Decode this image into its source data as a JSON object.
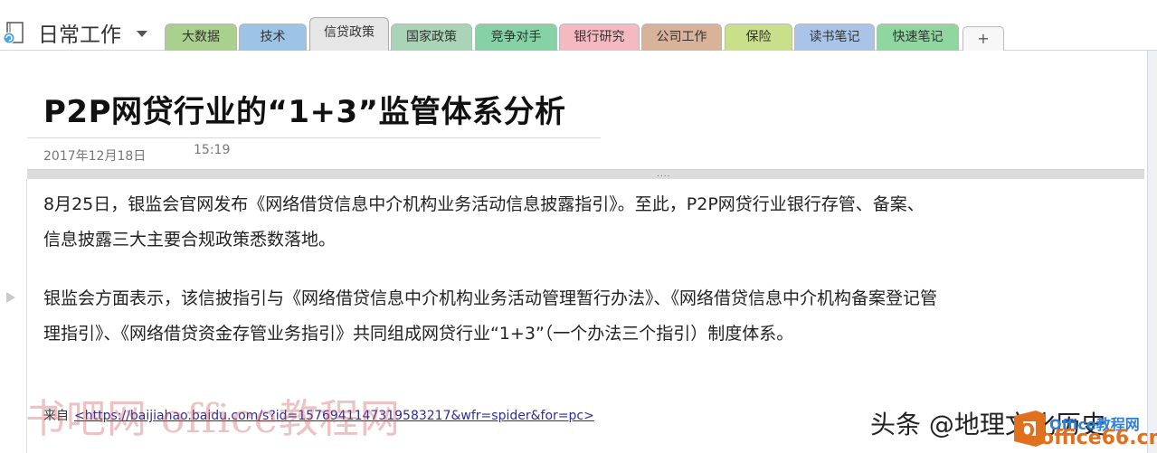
{
  "notebook": {
    "title": "日常工作"
  },
  "tabs": [
    {
      "label": "大数据",
      "color": "#a9d08e",
      "active": false
    },
    {
      "label": "技术",
      "color": "#9dc3e6",
      "active": false
    },
    {
      "label": "信贷政策",
      "color": "#e7e6e6",
      "active": true
    },
    {
      "label": "国家政策",
      "color": "#a9d5b6",
      "active": false
    },
    {
      "label": "竞争对手",
      "color": "#86d2a6",
      "active": false
    },
    {
      "label": "银行研究",
      "color": "#f4b9c1",
      "active": false
    },
    {
      "label": "公司工作",
      "color": "#d8b39a",
      "active": false
    },
    {
      "label": "保险",
      "color": "#c9df8a",
      "active": false
    },
    {
      "label": "读书笔记",
      "color": "#a9c4e8",
      "active": false
    },
    {
      "label": "快速笔记",
      "color": "#8fd6a0",
      "active": false
    }
  ],
  "add_tab_label": "+",
  "page": {
    "title": "P2P网贷行业的“1+3”监管体系分析",
    "date": "2017年12月18日",
    "time": "15:19",
    "grip": "....",
    "paragraphs": [
      "8月25日，银监会官网发布《网络借贷信息中介机构业务活动信息披露指引》。至此，P2P网贷行业银行存管、备案、信息披露三大主要合规政策悉数落地。",
      "银监会方面表示，该信披指引与《网络借贷信息中介机构业务活动管理暂行办法》、《网络借贷信息中介机构备案登记管理指引》、《网络借贷资金存管业务指引》共同组成网贷行业“1+3”（一个办法三个指引）制度体系。"
    ],
    "source_label": "来自",
    "source_url": "<https://baijiahao.baidu.com/s?id=1576941147319583217&wfr=spider&for=pc>"
  },
  "watermarks": {
    "left": "书吧网 office教程网",
    "toutiao": "头条 @地理文化历史",
    "brand_top": "Office教程网",
    "brand_bottom": "office66.cn",
    "logo_letter": "O"
  },
  "colors": {
    "brand_orange": "#e0701e",
    "brand_blue": "#2f7fd3"
  }
}
